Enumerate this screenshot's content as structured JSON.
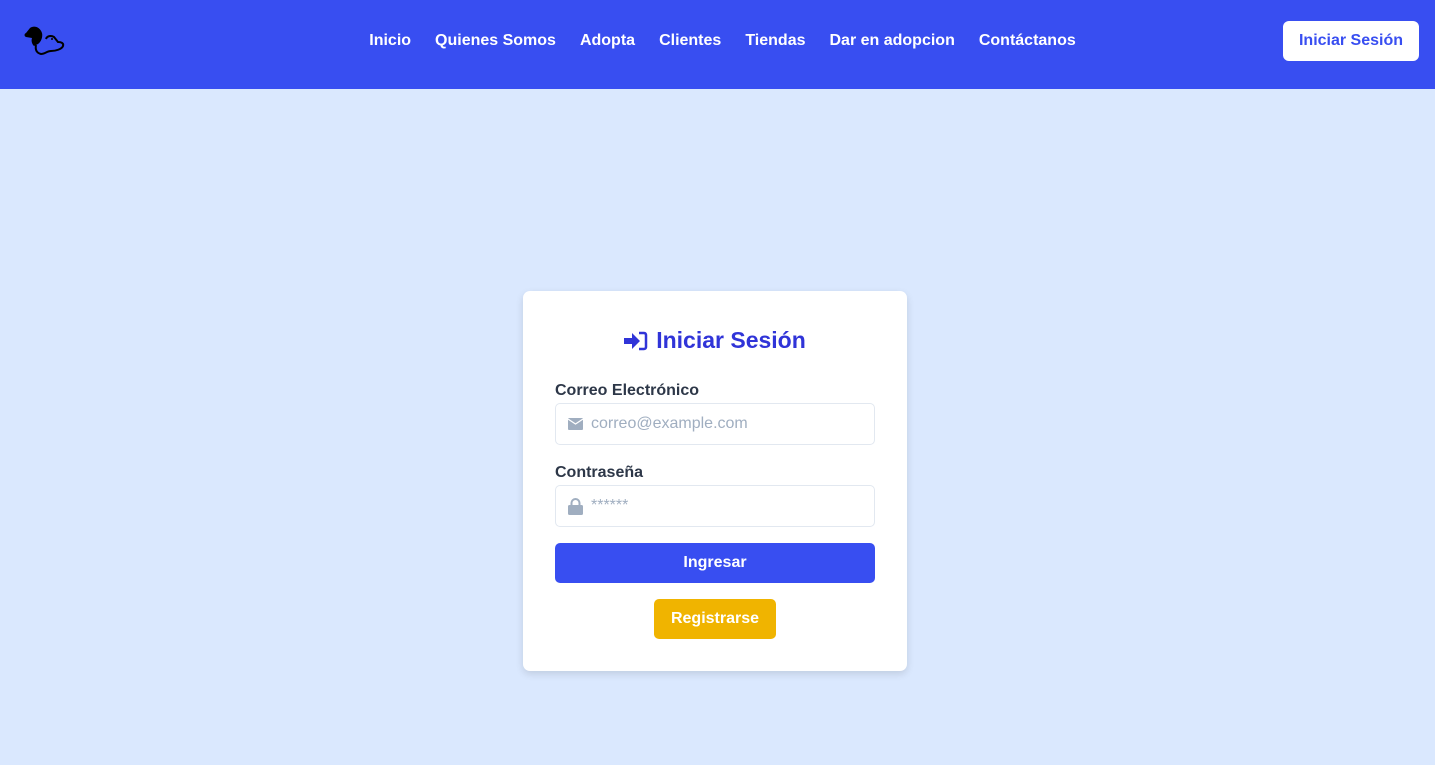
{
  "nav": {
    "links": [
      "Inicio",
      "Quienes Somos",
      "Adopta",
      "Clientes",
      "Tiendas",
      "Dar en adopcion",
      "Contáctanos"
    ],
    "login_label": "Iniciar Sesión"
  },
  "colors": {
    "primary": "#384ef1",
    "background": "#dae8fe",
    "secondary": "#f0b400"
  },
  "form": {
    "title": "Iniciar Sesión",
    "email_label": "Correo Electrónico",
    "email_placeholder": "correo@example.com",
    "password_label": "Contraseña",
    "password_placeholder": "******",
    "submit": "Ingresar",
    "register": "Registrarse"
  }
}
